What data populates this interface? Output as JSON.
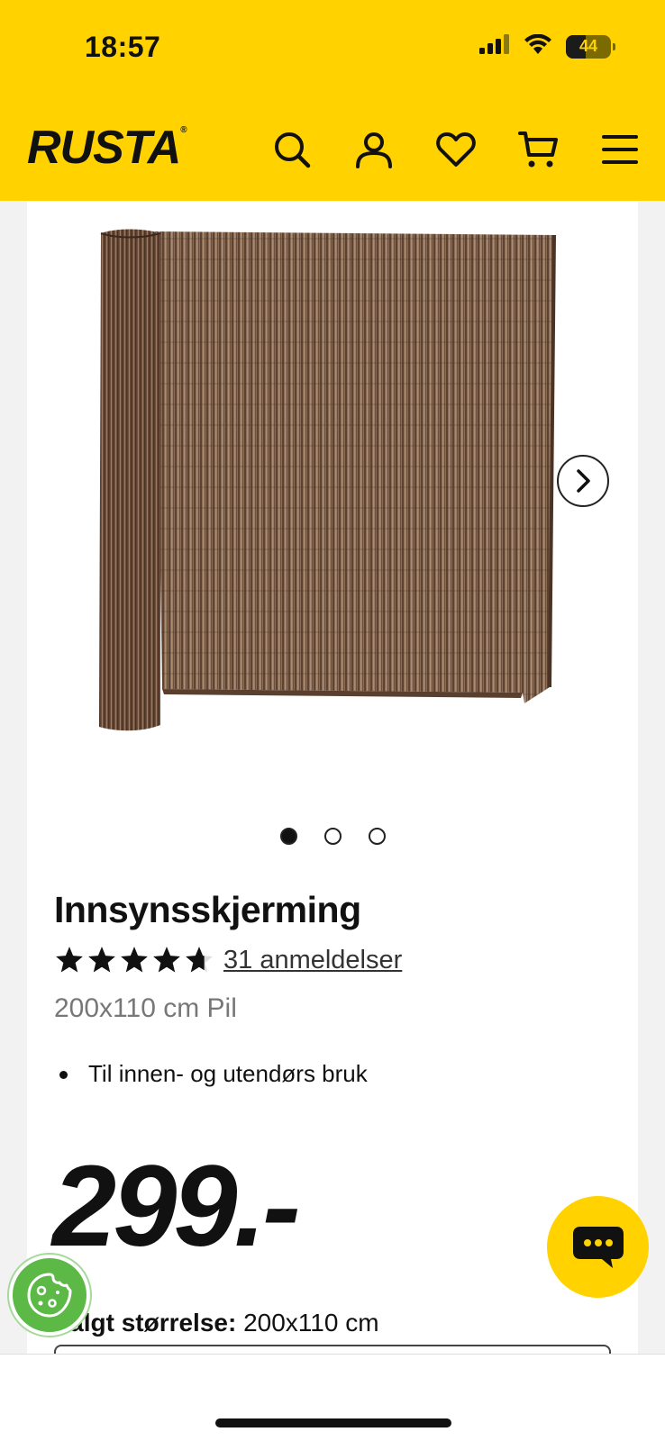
{
  "status_bar": {
    "time": "18:57",
    "battery_level": "44",
    "signal_icon": "cellular-signal-icon",
    "wifi_icon": "wifi-icon"
  },
  "header": {
    "logo_text": "RUSTA",
    "logo_mark": "®",
    "icons": [
      "search-icon",
      "user-icon",
      "heart-icon",
      "cart-icon",
      "menu-icon"
    ],
    "brand_color": "#ffd200"
  },
  "gallery": {
    "slide_count": 3,
    "active_slide": 1
  },
  "product": {
    "title": "Innsynsskjerming",
    "rating": 4.7,
    "reviews_label": "31 anmeldelser",
    "subtitle": "200x110 cm Pil",
    "bullets": [
      "Til innen- og utendørs bruk"
    ],
    "price": "299.-",
    "size_label": "Valgt størrelse:",
    "size_value": "200x110 cm"
  }
}
